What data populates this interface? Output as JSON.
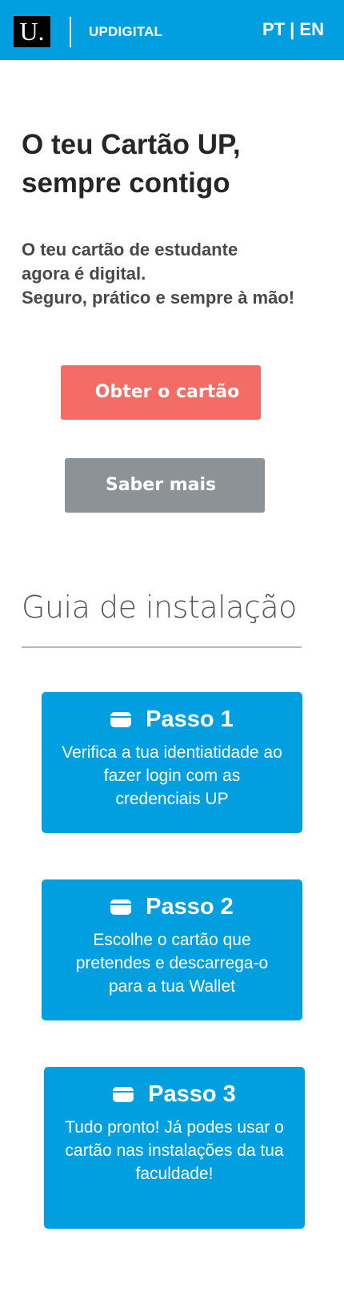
{
  "header": {
    "logo_text": "U.",
    "brand": "UPDIGITAL",
    "language_switch": "PT | EN"
  },
  "hero": {
    "title": "O teu Cartão UP, sempre contigo",
    "subtitle_lines": [
      "O teu cartão de estudante",
      "agora é digital.",
      "Seguro, prático e sempre à mão!"
    ],
    "primary_button": "Obter o cartão",
    "secondary_button": "Saber mais"
  },
  "guide": {
    "title": "Guia  de instalação",
    "steps": [
      {
        "title": "Passo 1",
        "text": "Verifica a tua identiatidade ao fazer login com as credenciais UP",
        "icon": "card-icon"
      },
      {
        "title": "Passo 2",
        "text": "Escolhe o cartão que pretendes e descarrega-o para a tua Wallet",
        "icon": "card-icon"
      },
      {
        "title": "Passo 3",
        "text": "Tudo pronto! Já podes usar o cartão nas instalações da tua faculdade!",
        "icon": "card-icon"
      }
    ]
  },
  "colors": {
    "primary_blue": "#029fe0",
    "primary_button": "#f56b66",
    "secondary_button": "#8d9297"
  }
}
